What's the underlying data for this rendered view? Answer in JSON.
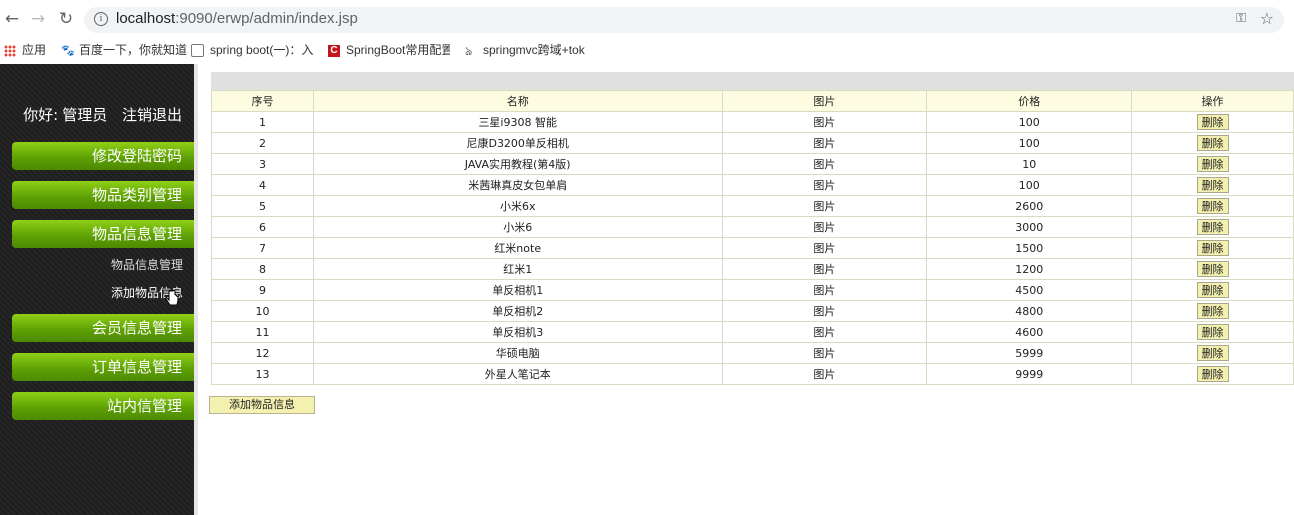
{
  "browser": {
    "url_host": "localhost",
    "url_rest": ":9090/erwp/admin/index.jsp",
    "bookmarks": [
      {
        "label": "应用",
        "icon": "apps-icon"
      },
      {
        "label": "百度一下，你就知道",
        "icon": "baidu-icon"
      },
      {
        "label": "spring boot(一)：入",
        "icon": "bookmark-page-icon"
      },
      {
        "label": "SpringBoot常用配置",
        "icon": "csdn-icon"
      },
      {
        "label": "springmvc跨域+tok",
        "icon": "bookmark-s-icon"
      }
    ]
  },
  "sidebar": {
    "greeting": "你好:",
    "user": "管理员",
    "logout": "注销退出",
    "menu": [
      "修改登陆密码",
      "物品类别管理",
      "物品信息管理",
      "会员信息管理",
      "订单信息管理",
      "站内信管理"
    ],
    "sub_items": [
      "物品信息管理",
      "添加物品信息"
    ]
  },
  "table": {
    "headers": [
      "序号",
      "名称",
      "图片",
      "价格",
      "操作"
    ],
    "rows": [
      {
        "no": "1",
        "name": "三星i9308 智能",
        "img": "图片",
        "price": "100",
        "op": "删除"
      },
      {
        "no": "2",
        "name": "尼康D3200单反相机",
        "img": "图片",
        "price": "100",
        "op": "删除"
      },
      {
        "no": "3",
        "name": "JAVA实用教程(第4版)",
        "img": "图片",
        "price": "10",
        "op": "删除"
      },
      {
        "no": "4",
        "name": "米茜琳真皮女包单肩",
        "img": "图片",
        "price": "100",
        "op": "删除"
      },
      {
        "no": "5",
        "name": "小米6x",
        "img": "图片",
        "price": "2600",
        "op": "删除"
      },
      {
        "no": "6",
        "name": "小米6",
        "img": "图片",
        "price": "3000",
        "op": "删除"
      },
      {
        "no": "7",
        "name": "红米note",
        "img": "图片",
        "price": "1500",
        "op": "删除"
      },
      {
        "no": "8",
        "name": "红米1",
        "img": "图片",
        "price": "1200",
        "op": "删除"
      },
      {
        "no": "9",
        "name": "单反相机1",
        "img": "图片",
        "price": "4500",
        "op": "删除"
      },
      {
        "no": "10",
        "name": "单反相机2",
        "img": "图片",
        "price": "4800",
        "op": "删除"
      },
      {
        "no": "11",
        "name": "单反相机3",
        "img": "图片",
        "price": "4600",
        "op": "删除"
      },
      {
        "no": "12",
        "name": "华硕电脑",
        "img": "图片",
        "price": "5999",
        "op": "删除"
      },
      {
        "no": "13",
        "name": "外星人笔记本",
        "img": "图片",
        "price": "9999",
        "op": "删除"
      }
    ]
  },
  "add_button": "添加物品信息"
}
